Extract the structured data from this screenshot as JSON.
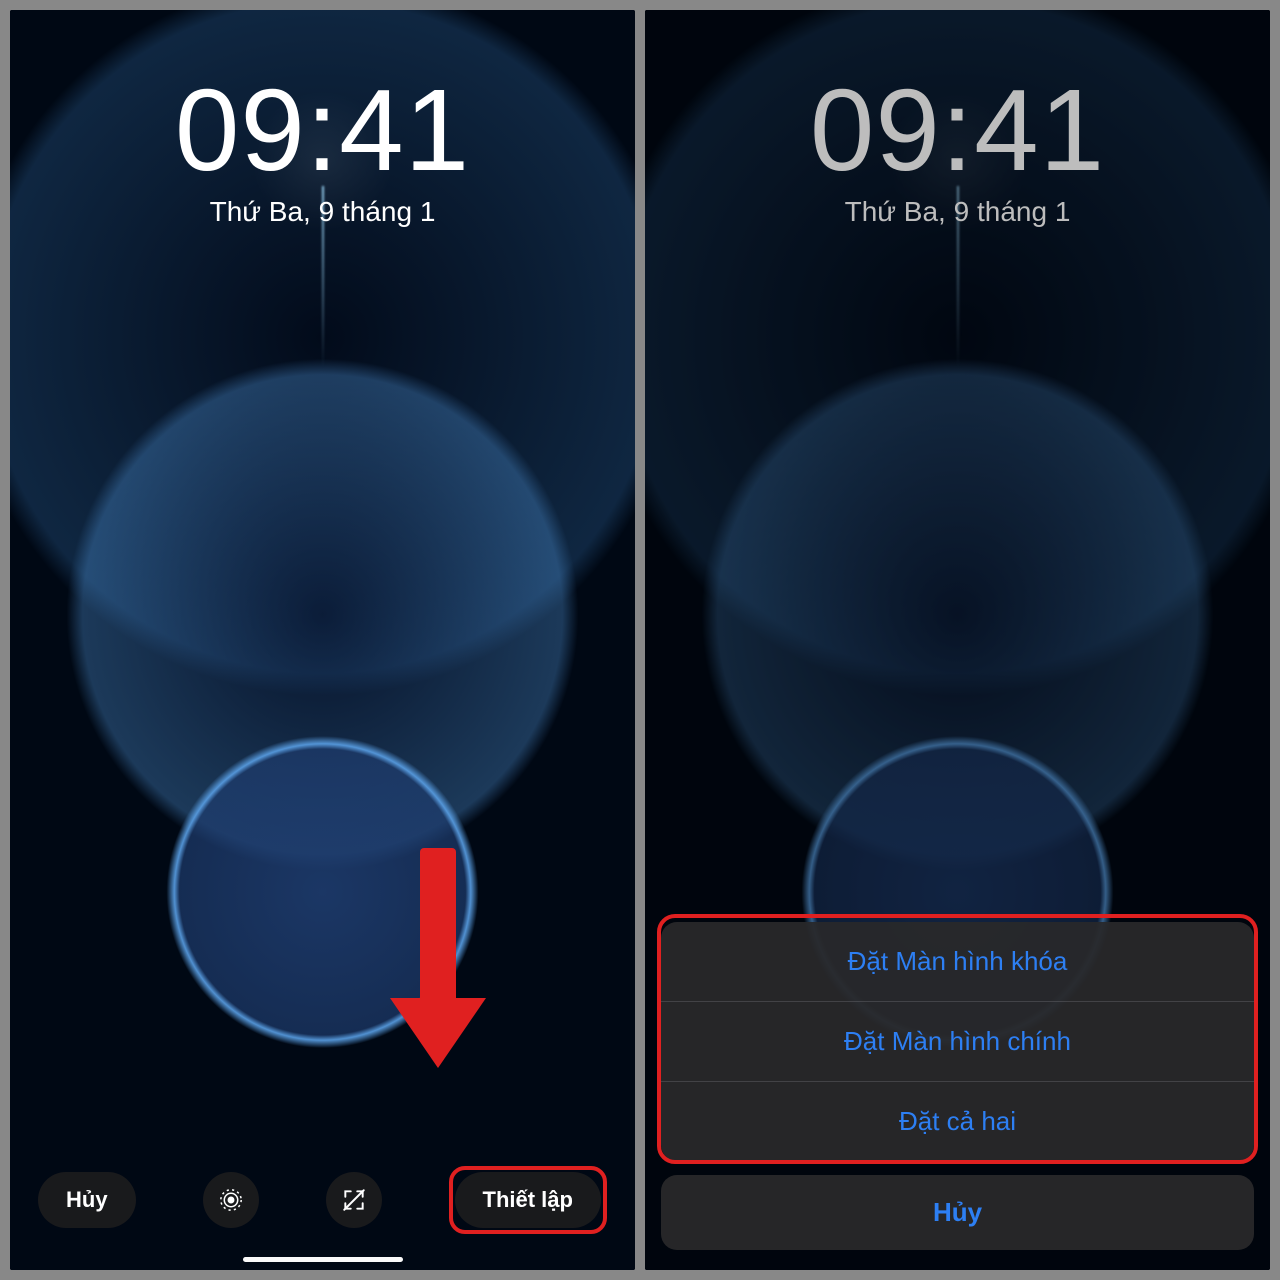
{
  "left": {
    "time": "09:41",
    "date": "Thứ Ba, 9 tháng 1",
    "cancel_label": "Hủy",
    "set_label": "Thiết lập"
  },
  "right": {
    "time": "09:41",
    "date": "Thứ Ba, 9 tháng 1",
    "sheet": {
      "options": [
        "Đặt Màn hình khóa",
        "Đặt Màn hình chính",
        "Đặt cả hai"
      ],
      "cancel": "Hủy"
    }
  },
  "colors": {
    "accent_link": "#2d7ff3",
    "annotation_red": "#e02020"
  }
}
